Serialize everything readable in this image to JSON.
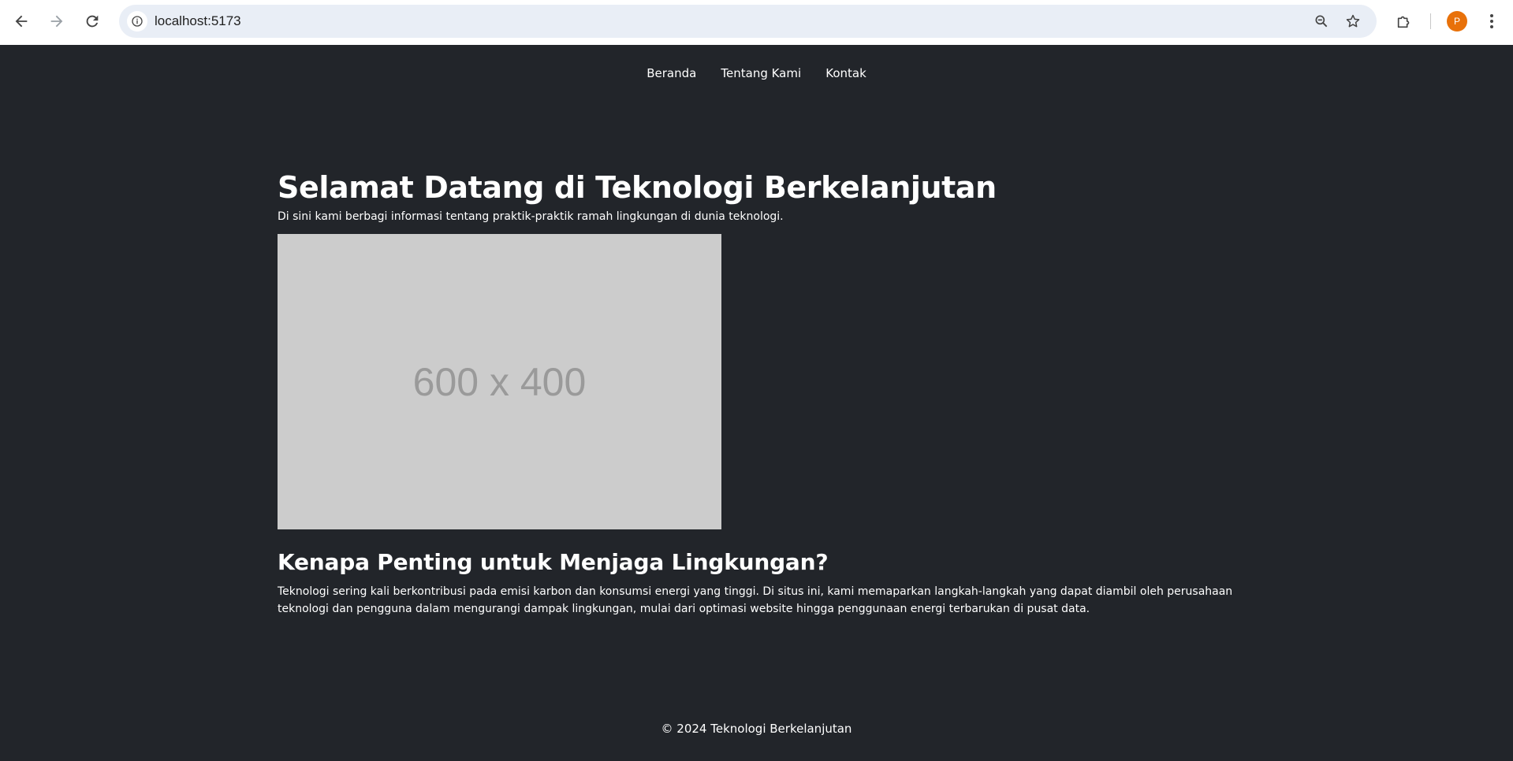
{
  "browser": {
    "url": "localhost:5173",
    "profile_initial": "P",
    "profile_color": "#e8710a"
  },
  "nav": {
    "items": [
      "Beranda",
      "Tentang Kami",
      "Kontak"
    ]
  },
  "hero": {
    "title": "Selamat Datang di Teknologi Berkelanjutan",
    "intro": "Di sini kami berbagi informasi tentang praktik-praktik ramah lingkungan di dunia teknologi.",
    "image_label": "600 x 400"
  },
  "section": {
    "title": "Kenapa Penting untuk Menjaga Lingkungan?",
    "body": "Teknologi sering kali berkontribusi pada emisi karbon dan konsumsi energi yang tinggi. Di situs ini, kami memaparkan langkah-langkah yang dapat diambil oleh perusahaan teknologi dan pengguna dalam mengurangi dampak lingkungan, mulai dari optimasi website hingga penggunaan energi terbarukan di pusat data."
  },
  "footer": {
    "text": "© 2024 Teknologi Berkelanjutan"
  },
  "colors": {
    "page_bg": "#22252a",
    "placeholder_bg": "#cccccc"
  }
}
